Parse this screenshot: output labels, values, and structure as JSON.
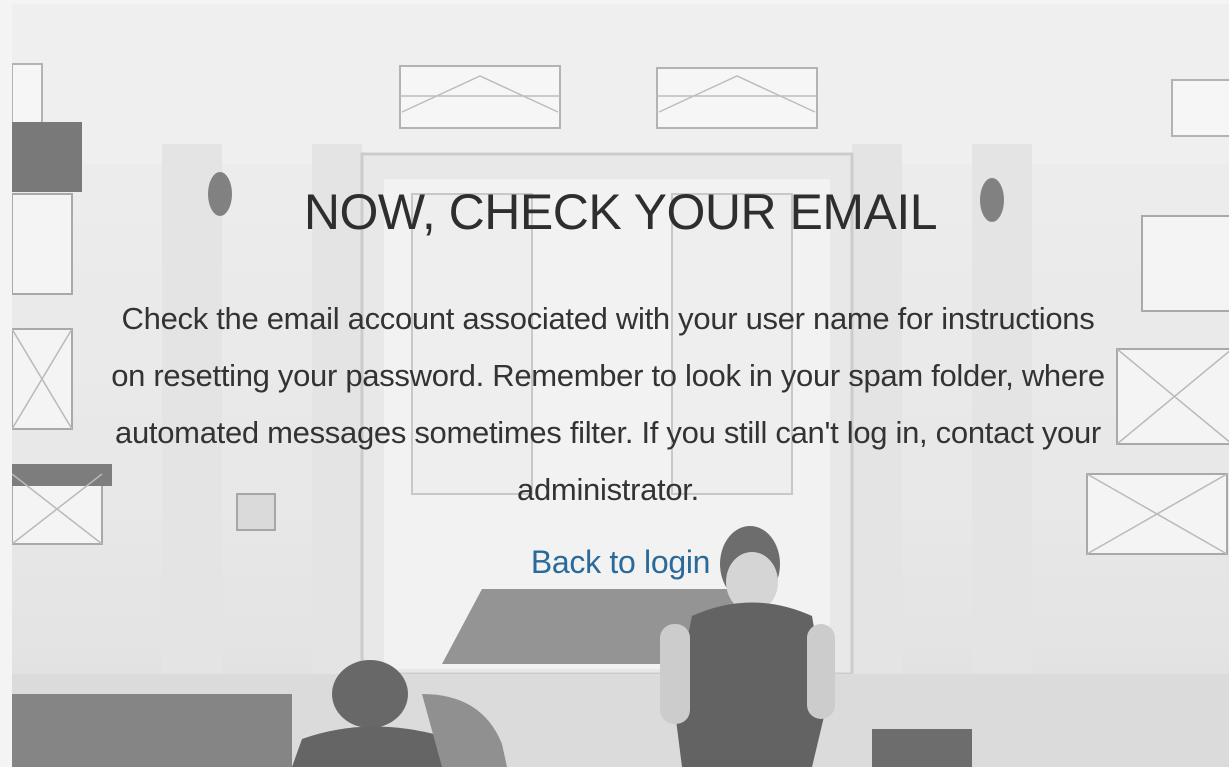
{
  "page": {
    "title": "NOW, CHECK YOUR EMAIL",
    "message": "Check the email account associated with your user name for instructions on resetting your password. Remember to look in your spam folder, where automated messages sometimes filter. If you still can't log in, contact your administrator.",
    "back_link_label": "Back to login"
  },
  "colors": {
    "title": "#2e2e2e",
    "body": "#333333",
    "link": "#2a6a9a",
    "background": "#e8e8e8"
  }
}
